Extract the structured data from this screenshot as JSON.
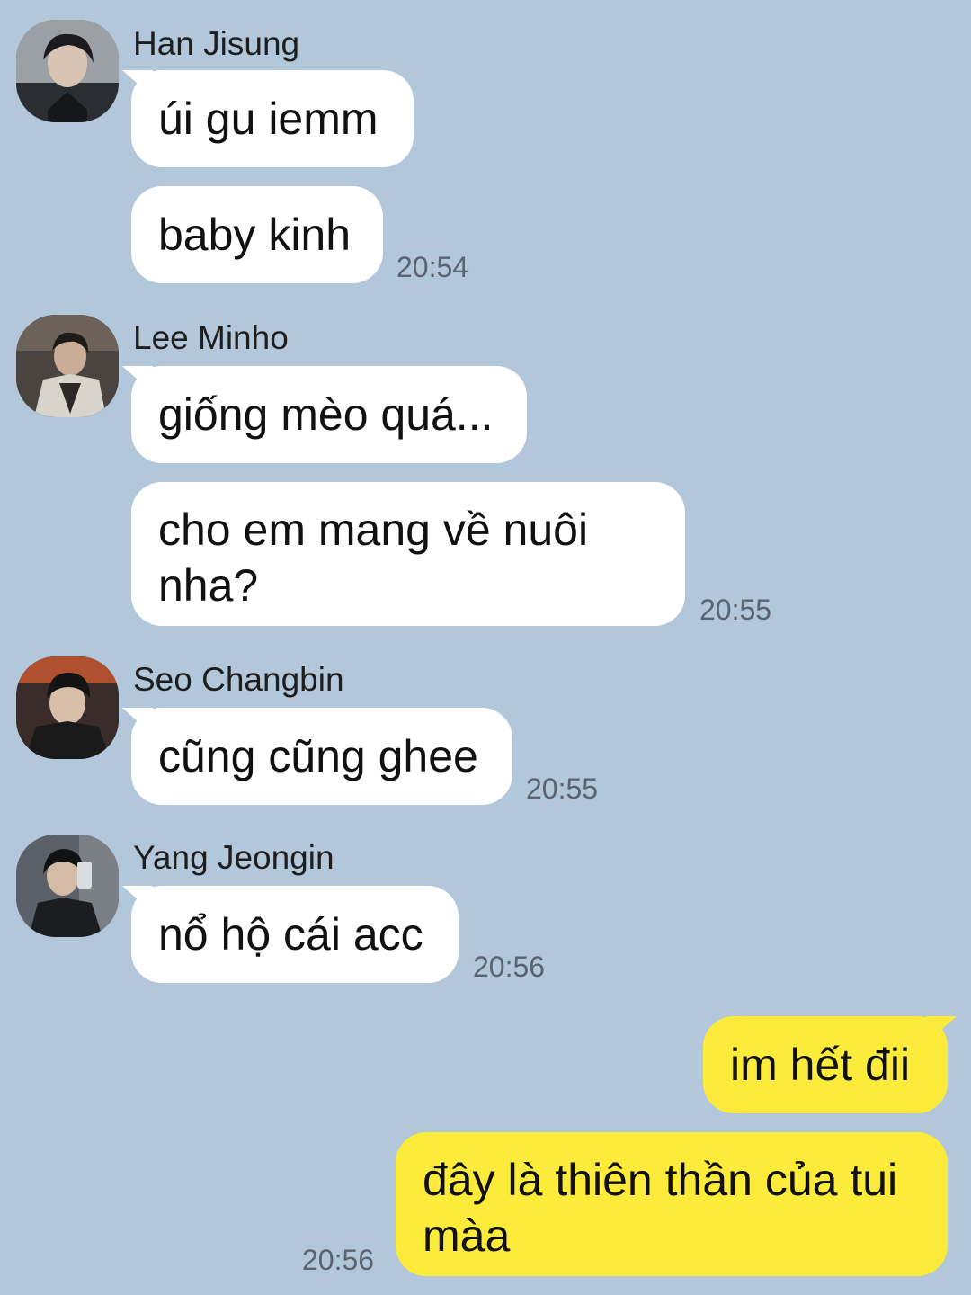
{
  "messages": [
    {
      "sender": "Han Jisung",
      "avatar": "han-jisung-avatar",
      "lines": [
        "úi gu iemm",
        "baby kinh"
      ],
      "time": "20:54"
    },
    {
      "sender": "Lee Minho",
      "avatar": "lee-minho-avatar",
      "lines": [
        "giống mèo quá...",
        "cho em mang về nuôi nha?"
      ],
      "time": "20:55"
    },
    {
      "sender": "Seo Changbin",
      "avatar": "seo-changbin-avatar",
      "lines": [
        "cũng cũng ghee"
      ],
      "time": "20:55"
    },
    {
      "sender": "Yang Jeongin",
      "avatar": "yang-jeongin-avatar",
      "lines": [
        "nổ hộ cái acc"
      ],
      "time": "20:56"
    }
  ],
  "my_messages": {
    "lines": [
      "im hết đii",
      "đây là thiên thần của tui màa"
    ],
    "time": "20:56"
  },
  "colors": {
    "background": "#b2c7da",
    "incoming_bubble": "#ffffff",
    "outgoing_bubble": "#fceb3b",
    "timestamp": "#5a6470"
  }
}
